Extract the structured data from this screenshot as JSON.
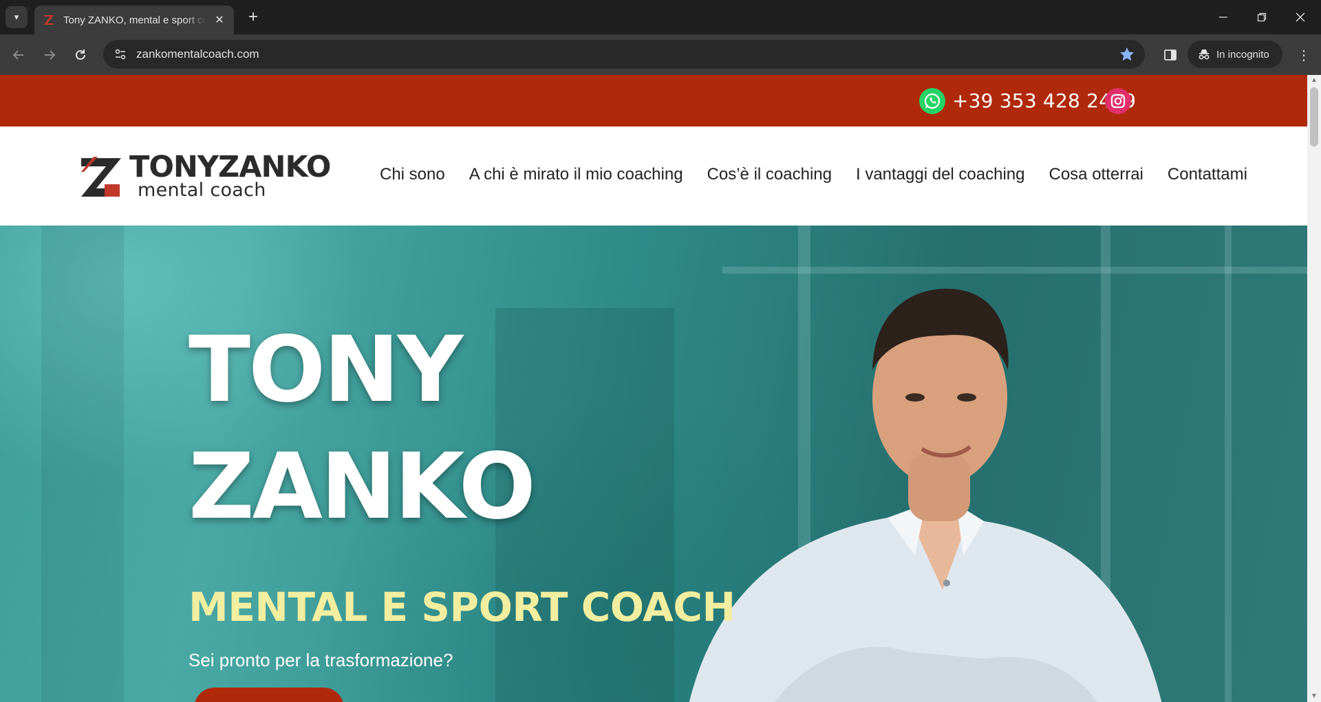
{
  "browser": {
    "tab_title": "Tony ZANKO, mental e sport coach",
    "url": "zankomentalcoach.com",
    "incognito_label": "In incognito"
  },
  "topbar": {
    "phone": "+39 353 428 2429",
    "bg_color": "#b0290b"
  },
  "header": {
    "logo_top": "TONYZANKO",
    "logo_sub": "mental coach",
    "nav": [
      {
        "label": "Chi sono"
      },
      {
        "label": "A chi è mirato il mio coaching"
      },
      {
        "label": "Cos’è il coaching"
      },
      {
        "label": "I vantaggi del coaching"
      },
      {
        "label": "Cosa otterrai"
      },
      {
        "label": "Contattami"
      }
    ]
  },
  "hero": {
    "title_line1": "TONY",
    "title_line2": "ZANKO",
    "subtitle": "MENTAL E SPORT COACH",
    "question": "Sei pronto per la trasformazione?",
    "accent_color": "#f2eea0"
  },
  "icons": {
    "whatsapp": "whatsapp-icon",
    "instagram": "instagram-icon",
    "star": "bookmark-star-icon"
  }
}
